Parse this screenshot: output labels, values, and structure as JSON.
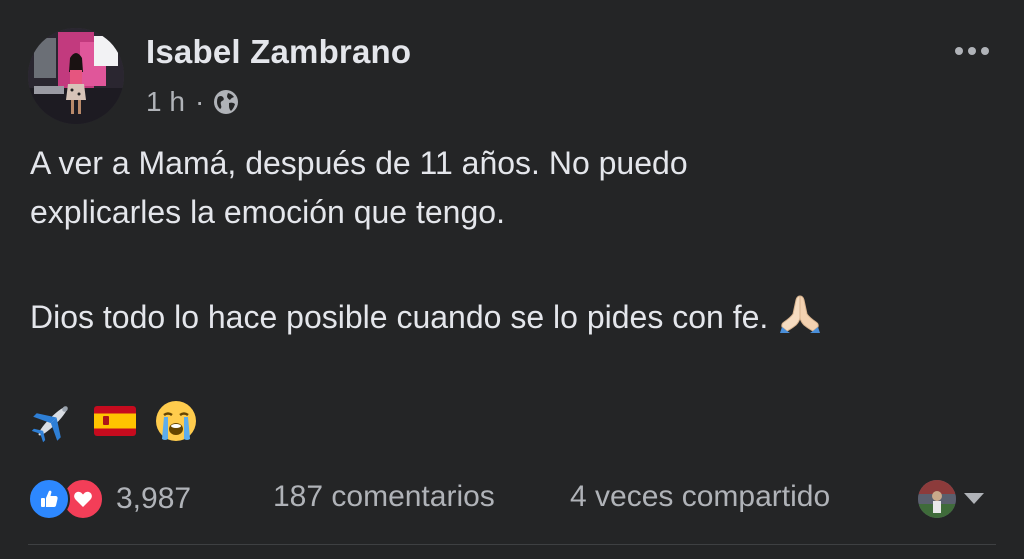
{
  "post": {
    "author": "Isabel Zambrano",
    "timestamp": "1 h",
    "separator": "·",
    "audience_icon": "globe-icon",
    "more_icon": "more-horizontal-icon",
    "lines": [
      "A ver a Mamá, después de 11 años. No puedo",
      "explicarles la emoción que tengo.",
      "Dios todo lo hace posible cuando se lo pides con fe."
    ],
    "emojis": [
      "✈️",
      "🇪🇸",
      "😭"
    ],
    "pray_emoji": "🙏"
  },
  "footer": {
    "reaction_icons": [
      "like-icon",
      "love-icon"
    ],
    "reaction_count": "3,987",
    "comments": "187 comentarios",
    "shares": "4 veces compartido"
  },
  "colors": {
    "background": "#242526",
    "primary_text": "#e4e6eb",
    "secondary_text": "#b0b3b8",
    "like": "#2d88ff",
    "love": "#f33e58"
  }
}
